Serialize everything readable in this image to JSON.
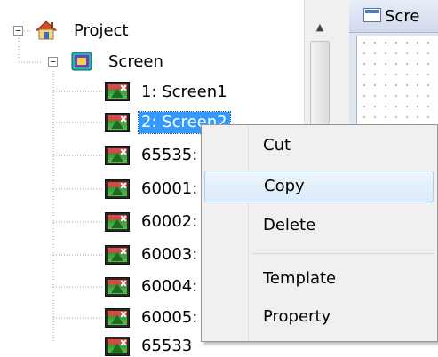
{
  "tree": {
    "root": {
      "label": "Project",
      "toggle": "⊟",
      "icon": "project-house-icon"
    },
    "screen_group": {
      "label": "Screen",
      "toggle": "⊟",
      "icon": "screen-folder-icon"
    },
    "items": [
      {
        "label": "1: Screen1",
        "icon": "screen-picture-icon",
        "selected": false
      },
      {
        "label": "2: Screen2",
        "icon": "screen-picture-icon",
        "selected": true
      },
      {
        "label": "65535:",
        "icon": "screen-picture-icon",
        "selected": false
      },
      {
        "label": "60001:",
        "icon": "screen-picture-icon",
        "selected": false
      },
      {
        "label": "60002:",
        "icon": "screen-picture-icon",
        "selected": false
      },
      {
        "label": "60003:",
        "icon": "screen-picture-icon",
        "selected": false
      },
      {
        "label": "60004:",
        "icon": "screen-picture-icon",
        "selected": false
      },
      {
        "label": "60005:",
        "icon": "screen-picture-icon",
        "selected": false
      },
      {
        "label": "65533",
        "icon": "screen-picture-icon",
        "selected": false
      }
    ]
  },
  "scrollbar": {
    "up_arrow": "▲"
  },
  "design_tab": {
    "title": "Scre",
    "icon": "screen-window-icon"
  },
  "context_menu": {
    "items": [
      {
        "label": "Cut"
      },
      {
        "label": "Copy",
        "hover": true
      },
      {
        "label": "Delete"
      },
      {
        "label": "Template"
      },
      {
        "label": "Property"
      }
    ]
  },
  "colors": {
    "selection": "#3399ff",
    "menu_hover_border": "#a8d2f5",
    "menu_bg": "#f0f0f0"
  }
}
